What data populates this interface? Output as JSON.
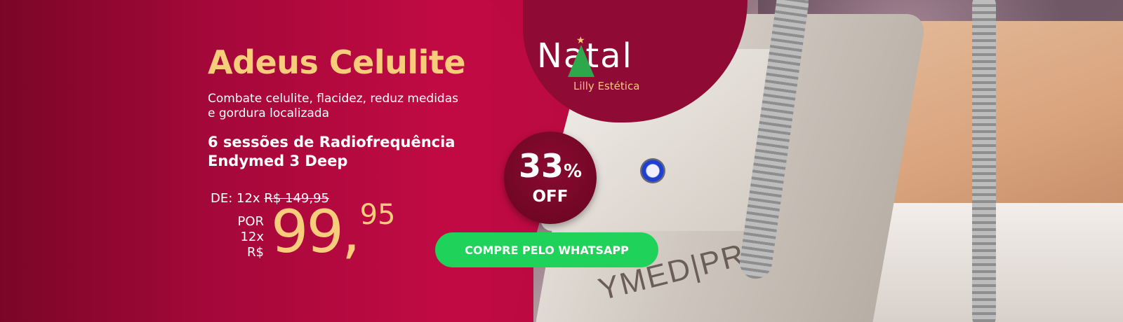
{
  "banner": {
    "title": "Adeus Celulite",
    "subtitle": "Combate celulite, flacidez, reduz medidas e gordura localizada",
    "sessions": "6 sessões de Radiofrequência Endymed 3 Deep",
    "price_from_prefix": "DE: 12x",
    "price_from_value": "R$ 149,95",
    "price_now_prefix_line1": "POR 12x",
    "price_now_prefix_line2": "R$",
    "price_now_int": "99,",
    "price_now_cents": "95",
    "discount_pct": "33",
    "discount_symbol": "%",
    "discount_label": "OFF",
    "cta_label": "COMPRE PELO WHATSAPP"
  },
  "logo": {
    "word": "Natal",
    "sub": "Lilly Estética",
    "star": "★"
  },
  "photo": {
    "device_text": "YMED|PRO"
  },
  "colors": {
    "background": "#b8083f",
    "accent_gold": "#f7cc7a",
    "cta_green": "#1fd35a",
    "badge": "#7a0628"
  }
}
